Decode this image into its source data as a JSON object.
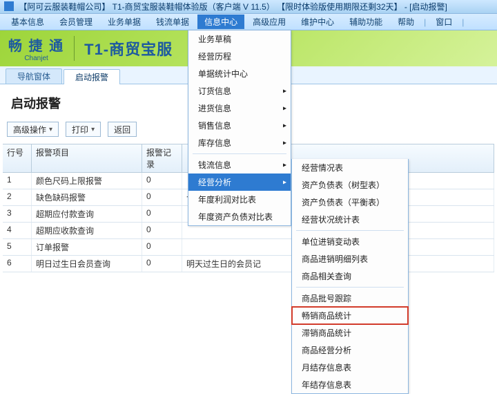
{
  "titlebar": "【阿可云服装鞋帽公司】  T1-商贸宝服装鞋帽体验版（客户端 V 11.5） 【限时体验版使用期限还剩32天】 - [启动报警]",
  "menu": {
    "items": [
      "基本信息",
      "会员管理",
      "业务单据",
      "钱流单据",
      "信息中心",
      "高级应用",
      "维护中心",
      "辅助功能",
      "帮助"
    ],
    "window": "窗口",
    "activeIndex": 4
  },
  "logo": {
    "cn": "畅 捷 通",
    "en": "Chanjet"
  },
  "brand": "T1-商贸宝服",
  "tabs": {
    "items": [
      "导航窗体",
      "启动报警"
    ],
    "activeIndex": 1
  },
  "heading": "启动报警",
  "toolbar": {
    "adv": "高级操作",
    "print": "打印",
    "back": "返回"
  },
  "grid": {
    "headers": {
      "no": "行号",
      "item": "报警项目",
      "cnt": "报警记录",
      "rest": ""
    },
    "rows": [
      {
        "no": "1",
        "item": "颜色尺码上限报警",
        "cnt": "0",
        "rest": ""
      },
      {
        "no": "2",
        "item": "缺色缺码报警",
        "cnt": "0",
        "rest": "仓库合计数量报警条"
      },
      {
        "no": "3",
        "item": "超期应付款查询",
        "cnt": "0",
        "rest": ""
      },
      {
        "no": "4",
        "item": "超期应收款查询",
        "cnt": "0",
        "rest": ""
      },
      {
        "no": "5",
        "item": "订单报警",
        "cnt": "0",
        "rest": ""
      },
      {
        "no": "6",
        "item": "明日过生日会员查询",
        "cnt": "0",
        "rest": "明天过生日的会员记"
      }
    ]
  },
  "dd1": {
    "items": [
      {
        "label": "业务草稿",
        "arrow": false
      },
      {
        "label": "经营历程",
        "arrow": false
      },
      {
        "label": "单据统计中心",
        "arrow": false
      },
      {
        "label": "订货信息",
        "arrow": true
      },
      {
        "label": "进货信息",
        "arrow": true
      },
      {
        "label": "销售信息",
        "arrow": true
      },
      {
        "label": "库存信息",
        "arrow": true
      },
      {
        "sep": true
      },
      {
        "label": "钱流信息",
        "arrow": true
      },
      {
        "label": "经营分析",
        "arrow": true,
        "hover": true
      },
      {
        "label": "年度利润对比表",
        "arrow": false
      },
      {
        "label": "年度资产负债对比表",
        "arrow": false
      }
    ]
  },
  "dd2": {
    "items": [
      {
        "label": "经营情况表"
      },
      {
        "label": "资产负债表（树型表）"
      },
      {
        "label": "资产负债表（平衡表）"
      },
      {
        "label": "经营状况统计表"
      },
      {
        "sep": true
      },
      {
        "label": "单位进销变动表"
      },
      {
        "label": "商品进销明细列表"
      },
      {
        "label": "商品相关查询"
      },
      {
        "sep": true
      },
      {
        "label": "商品批号跟踪"
      },
      {
        "label": "畅销商品统计",
        "highlight": true
      },
      {
        "label": "滞销商品统计"
      },
      {
        "label": "商品经营分析"
      },
      {
        "label": "月结存信息表"
      },
      {
        "label": "年结存信息表"
      }
    ]
  }
}
